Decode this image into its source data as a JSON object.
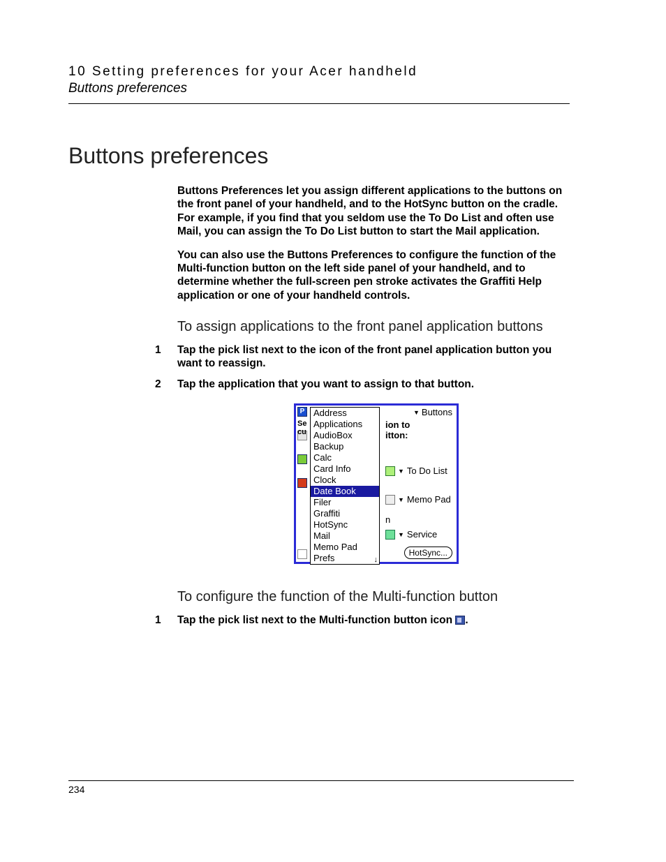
{
  "header": {
    "running_title": "10 Setting preferences for your Acer handheld",
    "running_sub": "Buttons preferences"
  },
  "h1": "Buttons preferences",
  "paras": [
    "Buttons Preferences let you assign different applications to the buttons on the front panel of your handheld, and to the HotSync button on the cradle. For example, if you find that you seldom use the To Do List and often use Mail, you can assign the To Do List button to start the Mail application.",
    "You can also use the Buttons Preferences to configure the function of the Multi-function button on the left side panel of your handheld, and to determine whether the full-screen pen stroke activates the Graffiti Help application or one of your handheld controls."
  ],
  "section1": {
    "title": "To assign applications to the front panel application buttons",
    "steps": [
      "Tap the pick list next to the icon of the front panel application button you want to reassign.",
      "Tap the application that you want to assign to that button."
    ]
  },
  "palm": {
    "title_picker": "Buttons",
    "left_text": {
      "se": "Se",
      "cu": "cu"
    },
    "picklist": [
      "Address",
      "Applications",
      "AudioBox",
      "Backup",
      "Calc",
      "Card Info",
      "Clock",
      "Date Book",
      "Filer",
      "Graffiti",
      "HotSync",
      "Mail",
      "Memo Pad",
      "Prefs"
    ],
    "selected": "Date Book",
    "frag1": "ion to",
    "frag2": "itton:",
    "rb_todo": "To Do List",
    "rb_memo": "Memo Pad",
    "lone_n": "n",
    "rb_svc": "Service",
    "hotsync_btn": "HotSync..."
  },
  "section2": {
    "title": "To configure the function of the Multi-function button",
    "step1_pre": "Tap the pick list next to the Multi-function button icon ",
    "step1_post": "."
  },
  "page_number": "234"
}
